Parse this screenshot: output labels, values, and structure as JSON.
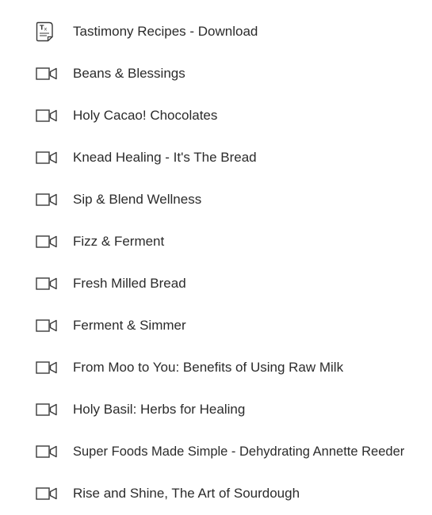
{
  "lessons": [
    {
      "title": "Tastimony Recipes - Download",
      "icon": "document-icon"
    },
    {
      "title": "Beans & Blessings",
      "icon": "video-icon"
    },
    {
      "title": "Holy Cacao! Chocolates",
      "icon": "video-icon"
    },
    {
      "title": "Knead Healing - It's The Bread",
      "icon": "video-icon"
    },
    {
      "title": "Sip & Blend Wellness",
      "icon": "video-icon"
    },
    {
      "title": "Fizz & Ferment",
      "icon": "video-icon"
    },
    {
      "title": "Fresh Milled Bread",
      "icon": "video-icon"
    },
    {
      "title": "Ferment & Simmer",
      "icon": "video-icon"
    },
    {
      "title": "From Moo to You: Benefits of Using Raw Milk",
      "icon": "video-icon"
    },
    {
      "title": "Holy Basil: Herbs for Healing",
      "icon": "video-icon"
    },
    {
      "title": "Super Foods Made Simple - Dehydrating Annette Reeder",
      "icon": "video-icon"
    },
    {
      "title": "Rise and Shine, The Art of Sourdough",
      "icon": "video-icon"
    }
  ],
  "colors": {
    "text": "#2b2b2b",
    "icon_stroke": "#3a3a3a",
    "background": "#ffffff"
  }
}
